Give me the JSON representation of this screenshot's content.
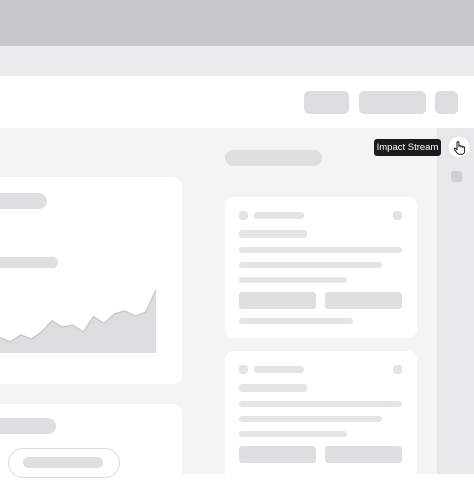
{
  "tooltip": {
    "text": "Impact Stream"
  },
  "icons": {
    "cursor": "hand-pointer-icon"
  },
  "colors": {
    "top_bar": "#c6c8ca",
    "workspace": "#f4f4f5",
    "skeleton": "#dedfe1",
    "tooltip_bg": "#1b1b1d"
  },
  "chart_placeholder": {
    "series_shape": [
      0.22,
      0.16,
      0.26,
      0.2,
      0.3,
      0.46,
      0.37,
      0.4,
      0.3,
      0.52,
      0.42,
      0.56,
      0.6,
      0.53,
      0.58,
      0.9
    ]
  }
}
